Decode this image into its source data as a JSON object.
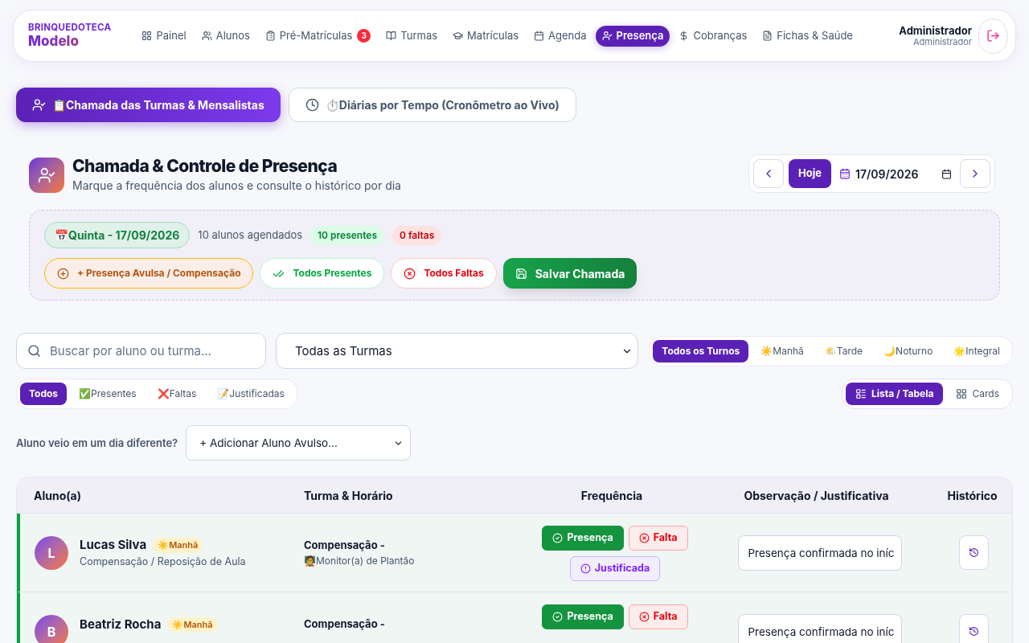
{
  "brand": {
    "top": "BRINQUEDOTECA",
    "bottom": "Modelo"
  },
  "nav": [
    {
      "label": "Painel",
      "selected": false
    },
    {
      "label": "Alunos",
      "selected": false
    },
    {
      "label": "Pré-Matrículas",
      "selected": false,
      "badge": "3"
    },
    {
      "label": "Turmas",
      "selected": false
    },
    {
      "label": "Matrículas",
      "selected": false
    },
    {
      "label": "Agenda",
      "selected": false
    },
    {
      "label": "Presença",
      "selected": true
    },
    {
      "label": "Cobranças",
      "selected": false
    },
    {
      "label": "Fichas & Saúde",
      "selected": false
    }
  ],
  "user": {
    "name": "Administrador",
    "role": "Administrador"
  },
  "mode_tabs": [
    {
      "label": "📋Chamada das Turmas & Mensalistas",
      "selected": true
    },
    {
      "label": "⏱️Diárias por Tempo (Cronômetro ao Vivo)",
      "selected": false
    }
  ],
  "header": {
    "title": "Chamada & Controle de Presença",
    "subtitle": "Marque a frequência dos alunos e consulte o histórico por dia"
  },
  "date_nav": {
    "today": "Hoje",
    "date": "17/09/2026"
  },
  "summary": {
    "date_chip": "📅Quinta - 17/09/2026",
    "scheduled": "10 alunos agendados",
    "present": "10 presentes",
    "absent": "0 faltas"
  },
  "actions": [
    {
      "kind": "extra",
      "label": "+ Presença Avulsa / Compensação"
    },
    {
      "kind": "all_present",
      "label": "Todos Presentes"
    },
    {
      "kind": "all_absent",
      "label": "Todos Faltas"
    },
    {
      "kind": "save",
      "label": "Salvar Chamada"
    }
  ],
  "search": {
    "placeholder": "Buscar por aluno ou turma..."
  },
  "class_select": {
    "value": "Todas as Turmas"
  },
  "shift_filters": [
    {
      "label": "Todos os Turnos",
      "selected": true
    },
    {
      "label": "☀️Manhã",
      "selected": false
    },
    {
      "label": "🌤️Tarde",
      "selected": false
    },
    {
      "label": "🌙Noturno",
      "selected": false
    },
    {
      "label": "🌟Integral",
      "selected": false
    }
  ],
  "status_filters": [
    {
      "label": "Todos",
      "selected": true
    },
    {
      "label": "✅Presentes",
      "selected": false
    },
    {
      "label": "❌Faltas",
      "selected": false
    },
    {
      "label": "📝Justificadas",
      "selected": false
    }
  ],
  "view_toggle": [
    {
      "label": "Lista / Tabela",
      "selected": true
    },
    {
      "label": "Cards",
      "selected": false
    }
  ],
  "add_student": {
    "question": "Aluno veio em um dia diferente?",
    "value": "+ Adicionar Aluno Avulso..."
  },
  "table": {
    "columns": [
      "Aluno(a)",
      "Turma & Horário",
      "Frequência",
      "Observação / Justificativa",
      "Histórico"
    ],
    "rows": [
      {
        "initial": "L",
        "name": "Lucas Silva",
        "shift": "☀️Manhã",
        "subtitle": "Compensação / Reposição de Aula",
        "class_title": "Compensação -",
        "class_subtitle": "🧑‍🏫Monitor(a) de Plantão",
        "attendance": [
          {
            "kind": "present",
            "label": "Presença",
            "selected": true
          },
          {
            "kind": "absent",
            "label": "Falta",
            "selected": false
          },
          {
            "kind": "justified",
            "label": "Justificada",
            "selected": false
          }
        ],
        "note": "Presença confirmada no iníc"
      },
      {
        "initial": "B",
        "name": "Beatriz Rocha",
        "shift": "☀️Manhã",
        "class_title": "Compensação -",
        "attendance": [
          {
            "kind": "present",
            "label": "Presença",
            "selected": true
          },
          {
            "kind": "absent",
            "label": "Falta",
            "selected": false
          }
        ],
        "note": "Presença confirmada no iníc"
      }
    ]
  }
}
